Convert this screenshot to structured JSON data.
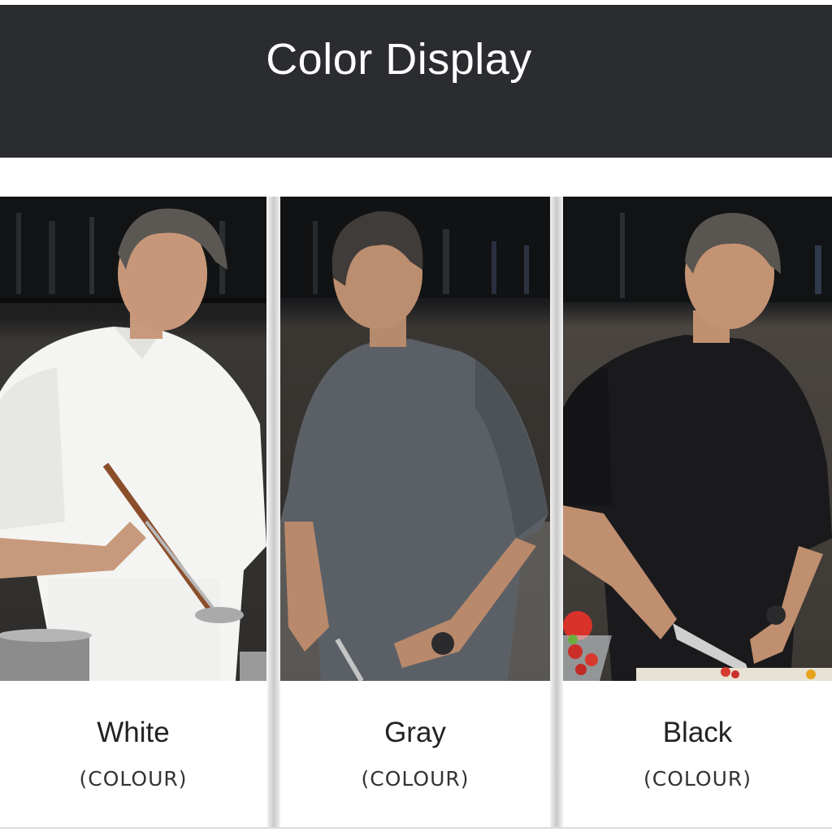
{
  "header": {
    "title": "Color Display",
    "background": "#2b2c30"
  },
  "cards": [
    {
      "label": "White",
      "sub": "(COLOUR)",
      "uniform_color": "#f4f4f2",
      "photo": "chef-in-white-uniform-with-ladle"
    },
    {
      "label": "Gray",
      "sub": "(COLOUR)",
      "uniform_color": "#5b6066",
      "photo": "chef-in-gray-uniform-cutting"
    },
    {
      "label": "Black",
      "sub": "(COLOUR)",
      "uniform_color": "#1a1a1c",
      "photo": "chef-in-black-uniform-cutting-vegetables"
    }
  ]
}
